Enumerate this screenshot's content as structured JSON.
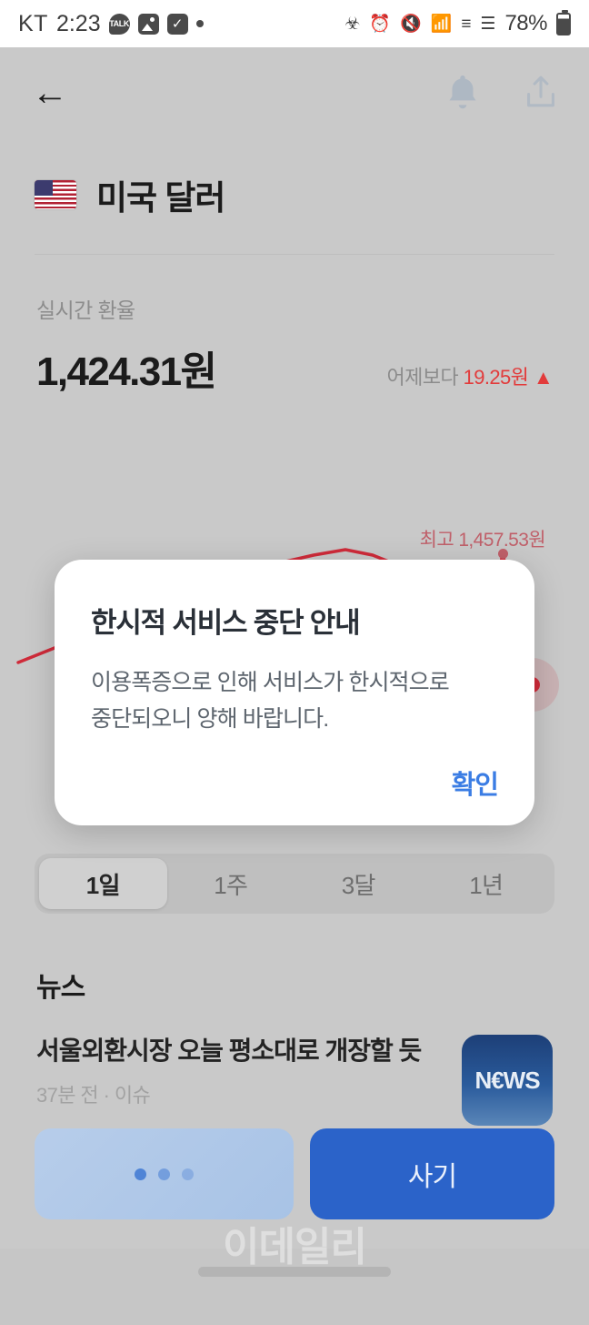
{
  "statusbar": {
    "carrier": "KT",
    "time": "2:23",
    "icons": [
      "kakaotalk-icon",
      "photo-icon",
      "check-icon",
      "dot-icon"
    ],
    "right_icons": [
      "battery-saver-icon",
      "alarm-icon",
      "mute-icon",
      "wifi-icon",
      "hd-icon",
      "signal-icon"
    ],
    "talk_label": "TALK",
    "check_glyph": "✓",
    "battery_percent": "78%"
  },
  "topbar": {
    "back_icon": "back-arrow-icon",
    "bell_icon": "bell-icon",
    "share_icon": "share-icon"
  },
  "currency": {
    "flag": "us-flag-icon",
    "name": "미국 달러",
    "rate_label": "실시간 환율",
    "rate_value": "1,424.31원",
    "change_prefix": "어제보다",
    "change_value": "19.25원",
    "change_arrow": "▲",
    "change_color": "#e23b3b"
  },
  "chart_data": {
    "type": "line",
    "title": "",
    "annotations": [
      {
        "label": "최고 1,457.53원",
        "value": 1457.53,
        "type": "high-marker"
      }
    ],
    "current_value": 1424.31,
    "line_color": "#cf2b3a",
    "x": [
      0,
      8,
      16,
      24,
      32,
      40,
      48,
      56,
      64,
      72,
      80,
      88,
      96,
      100
    ],
    "y": [
      1441.0,
      1448.5,
      1454.0,
      1457.53,
      1452.0,
      1443.0,
      1433.0,
      1427.5,
      1421.0,
      1418.5,
      1420.5,
      1423.0,
      1424.0,
      1424.31
    ],
    "ylim": [
      1414,
      1460
    ],
    "grid": false,
    "legend": false
  },
  "range_tabs": {
    "items": [
      {
        "label": "1일",
        "active": true
      },
      {
        "label": "1주",
        "active": false
      },
      {
        "label": "3달",
        "active": false
      },
      {
        "label": "1년",
        "active": false
      }
    ]
  },
  "news": {
    "heading": "뉴스",
    "items": [
      {
        "title": "서울외환시장 오늘 평소대로 개장할 듯",
        "meta": "37분 전 · 이슈",
        "thumb_label": "N€WS"
      }
    ]
  },
  "bottom": {
    "loading_label": "",
    "buy_label": "사기",
    "buy_color": "#2b63c9"
  },
  "watermark": "이데일리",
  "dialog": {
    "title": "한시적 서비스 중단 안내",
    "body_line1": "이용폭증으로 인해 서비스가 한시적으로",
    "body_line2": "중단되오니 양해 바랍니다.",
    "confirm_label": "확인",
    "confirm_color": "#3b7de4"
  }
}
